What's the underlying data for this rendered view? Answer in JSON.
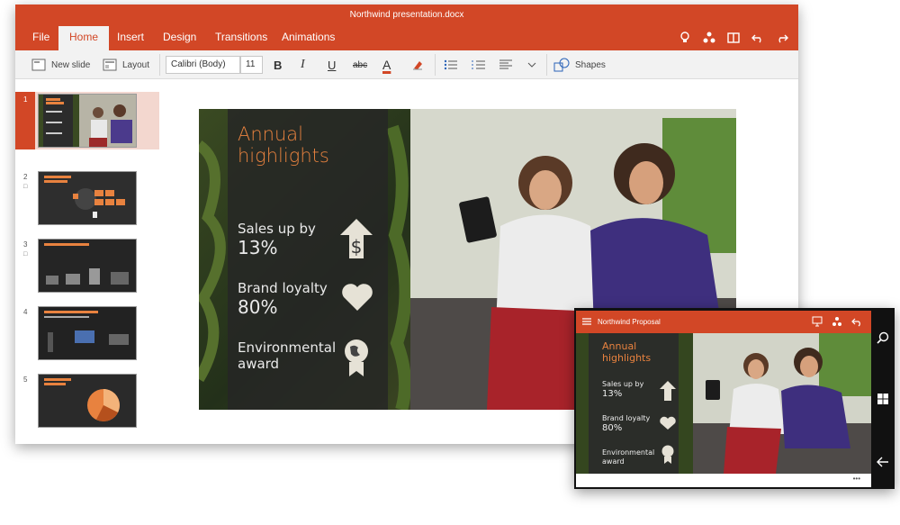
{
  "window": {
    "title": "Northwind presentation.docx"
  },
  "tabs": [
    {
      "label": "File"
    },
    {
      "label": "Home"
    },
    {
      "label": "Insert"
    },
    {
      "label": "Design"
    },
    {
      "label": "Transitions"
    },
    {
      "label": "Animations"
    }
  ],
  "toolbar": {
    "new_slide_label": "New slide",
    "layout_label": "Layout",
    "font_name": "Calibri (Body)",
    "font_size": "11",
    "bold_glyph": "B",
    "italic_glyph": "I",
    "underline_glyph": "U",
    "strike_glyph": "abc",
    "font_color_glyph": "A",
    "shapes_label": "Shapes"
  },
  "thumbnails": [
    {
      "number": "1"
    },
    {
      "number": "2"
    },
    {
      "number": "3"
    },
    {
      "number": "4"
    },
    {
      "number": "5"
    }
  ],
  "slide": {
    "title_line1": "Annual",
    "title_line2": "highlights",
    "item1_title": "Sales up by",
    "item1_value": "13%",
    "item2_title": "Brand loyalty",
    "item2_value": "80%",
    "item3_line1": "Environmental",
    "item3_line2": "award"
  },
  "phone": {
    "title": "Northwind Proposal",
    "more_glyph": "•••"
  },
  "colors": {
    "accent": "#d24726",
    "slide_title": "#e8823f"
  }
}
